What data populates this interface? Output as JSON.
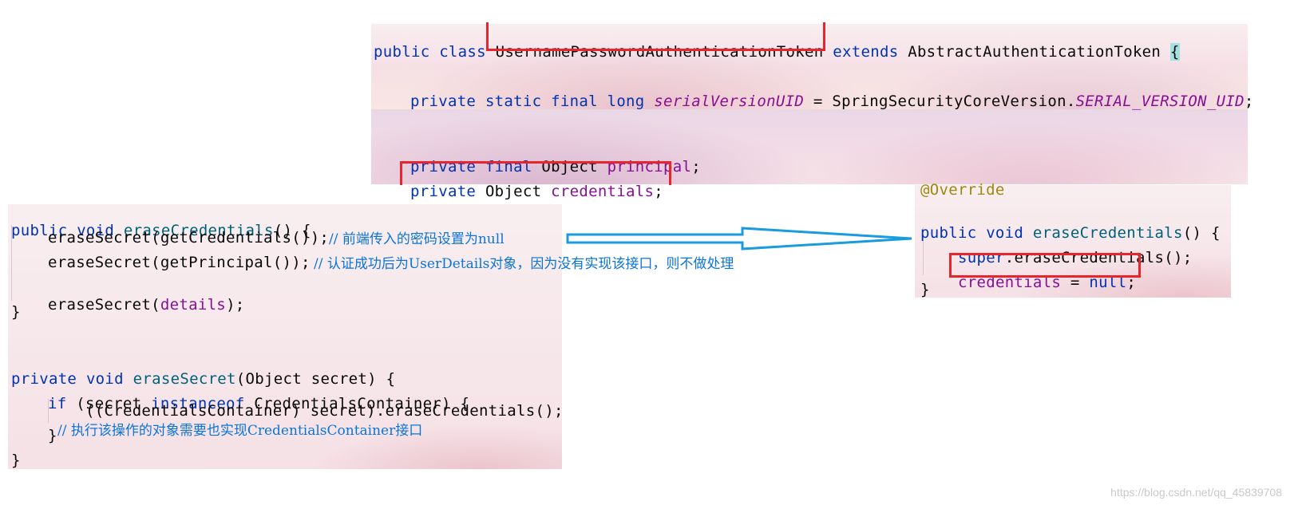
{
  "top_panel": {
    "line1": {
      "kw1": "public",
      "kw2": "class",
      "classname": "UsernamePasswordAuthenticationToken",
      "kw3": "extends",
      "parent": "AbstractAuthenticationToken",
      "brace": "{"
    },
    "line2": {
      "kw1": "private",
      "kw2": "static",
      "kw3": "final",
      "kw4": "long",
      "field": "serialVersionUID",
      "eq": " = SpringSecurityCoreVersion.",
      "const": "SERIAL_VERSION_UID",
      "end": ";"
    },
    "line3": {
      "kw1": "private",
      "kw2": "final",
      "type": "Object",
      "field": "principal",
      "end": ";"
    },
    "line4": {
      "kw1": "private",
      "type": "Object",
      "field": "credentials",
      "end": ";"
    }
  },
  "left_panel": {
    "l1": {
      "kw1": "public",
      "kw2": "void",
      "fn": "eraseCredentials",
      "rest": "() {"
    },
    "l2": {
      "code": "eraseSecret(getCredentials());",
      "comment": "// 前端传入的密码设置为null"
    },
    "l3": {
      "code": "eraseSecret(getPrincipal());",
      "comment": "// 认证成功后为UserDetails对象，因为没有实现该接口，则不做处理"
    },
    "l4": {
      "pre": "eraseSecret(",
      "field": "details",
      "post": ");"
    },
    "l5": {
      "text": "}"
    },
    "l6": {
      "kw1": "private",
      "kw2": "void",
      "fn": "eraseSecret",
      "rest": "(Object secret) {"
    },
    "l7": {
      "kw1": "if",
      "mid": " (secret ",
      "kw2": "instanceof",
      "rest": " CredentialsContainer) {"
    },
    "l8": {
      "code": "((CredentialsContainer) secret).eraseCredentials();"
    },
    "l9": {
      "brace": "}",
      "comment": "// 执行该操作的对象需要也实现CredentialsContainer接口"
    },
    "l10": {
      "text": "}"
    }
  },
  "right_panel": {
    "anno": "@Override",
    "r1": {
      "kw1": "public",
      "kw2": "void",
      "fn": "eraseCredentials",
      "rest": "() {"
    },
    "r2": {
      "kw": "super",
      "rest": ".eraseCredentials();"
    },
    "r3": {
      "field": "credentials",
      "eq": " = ",
      "kw": "null",
      "end": ";"
    },
    "r4": {
      "text": "}"
    }
  },
  "colors": {
    "highlight_box": "#e8242c",
    "arrow": "#1a9be0",
    "comment": "#0b74d9"
  },
  "watermark": "https://blog.csdn.net/qq_45839708"
}
